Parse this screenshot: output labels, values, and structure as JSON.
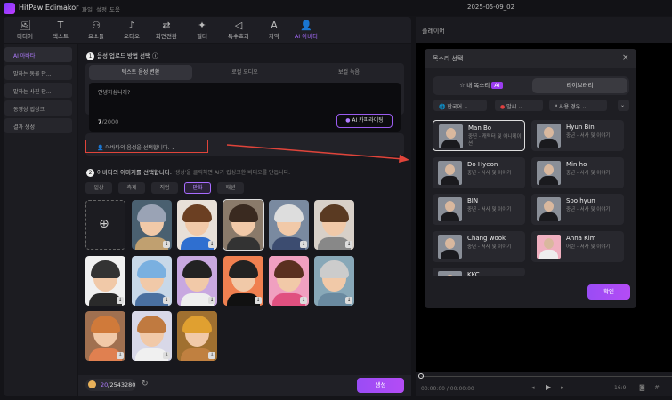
{
  "app": {
    "title": "HitPaw Edimakor",
    "menus": [
      "파일",
      "설정",
      "도움"
    ],
    "date": "2025-05-09_02"
  },
  "toolbar": [
    {
      "icon": "media-icon",
      "glyph": "🖼",
      "label": "미디어"
    },
    {
      "icon": "text-icon",
      "glyph": "T",
      "label": "텍스트"
    },
    {
      "icon": "elements-icon",
      "glyph": "⚇",
      "label": "요소들"
    },
    {
      "icon": "audio-icon",
      "glyph": "♪",
      "label": "오디오"
    },
    {
      "icon": "transition-icon",
      "glyph": "⇄",
      "label": "화면전환"
    },
    {
      "icon": "filter-icon",
      "glyph": "✦",
      "label": "필터"
    },
    {
      "icon": "effects-icon",
      "glyph": "◁",
      "label": "특수효과"
    },
    {
      "icon": "subtitle-icon",
      "glyph": "A",
      "label": "자막"
    },
    {
      "icon": "ai-avatar-icon",
      "glyph": "👤",
      "label": "AI 아바타",
      "active": true
    }
  ],
  "sidebar": [
    "AI 아바타",
    "말하는 동물 만...",
    "말하는 사진 만...",
    "동영상 립싱크",
    "결과 생성"
  ],
  "step1": {
    "num": "1",
    "title": "음성 업로드 방법 선택",
    "tabs": [
      "텍스트 음성 변환",
      "로컬 오디오",
      "보컬 녹음"
    ],
    "text": "안녕하십니까?",
    "count": "7",
    "max": "/2000",
    "ai_button": "AI 카피라이팅",
    "voice_select": "아바타의 음성을 선택합니다."
  },
  "step2": {
    "num": "2",
    "title": "아바타의 이미지를 선택합니다.",
    "hint": "'생성'을 클릭하면 AI가 립싱크한 비디오를 만듭니다.",
    "categories": [
      "일상",
      "축제",
      "직업",
      "만화",
      "패션"
    ],
    "active_category": "만화"
  },
  "avatars": [
    {
      "hair": "#9aa3b5",
      "bg": "#4a6070",
      "body": "#c0a070"
    },
    {
      "hair": "#6b3f22",
      "bg": "#e8e0d8",
      "body": "#2f6fd0"
    },
    {
      "hair": "#3a2a20",
      "bg": "#8a7a6a",
      "body": "#333"
    },
    {
      "hair": "#ddd",
      "bg": "#7a8aa0",
      "body": "#3c4c70"
    },
    {
      "hair": "#5a3a22",
      "bg": "#d8d0c8",
      "body": "#888"
    },
    {
      "hair": "#333",
      "bg": "#f0f0f0",
      "body": "#2a2a2a"
    },
    {
      "hair": "#7ab0e0",
      "bg": "#c8d8e8",
      "body": "#4a70a0"
    },
    {
      "hair": "#222",
      "bg": "#c8a8e0",
      "body": "#eee"
    },
    {
      "hair": "#222",
      "bg": "#f08050",
      "body": "#111"
    },
    {
      "hair": "#5a3020",
      "bg": "#f0a0c0",
      "body": "#e05080"
    },
    {
      "hair": "#ccc",
      "bg": "#88a8b8",
      "body": "#6a8aa0"
    },
    {
      "hair": "#d07a3a",
      "bg": "#a07050",
      "body": "#e08050"
    },
    {
      "hair": "#c07a40",
      "bg": "#d8d8e8",
      "body": "#f0f0f0"
    },
    {
      "hair": "#e0a030",
      "bg": "#a07030",
      "body": "#c08040"
    }
  ],
  "footer": {
    "credits_used": "20",
    "credits_total": "/2543280",
    "generate": "생성"
  },
  "player": {
    "title": "플레이어",
    "time": "00:00:00 / 00:00:00",
    "ratio": "16:9"
  },
  "modal": {
    "title": "목소리 선택",
    "tabs": [
      "내 목소리",
      "라이브러리"
    ],
    "ai_badge": "AI",
    "filters": [
      "한국어",
      "말씨",
      "사용 경우"
    ],
    "confirm": "확인",
    "voices": [
      {
        "name": "Man Bo",
        "desc": "중년 - 캐릭터 및 애니메이션",
        "selected": true
      },
      {
        "name": "Hyun Bin",
        "desc": "중년 - 서사 및 이야기"
      },
      {
        "name": "Do Hyeon",
        "desc": "중년 - 서사 및 이야기"
      },
      {
        "name": "Min ho",
        "desc": "중년 - 서사 및 이야기"
      },
      {
        "name": "BIN",
        "desc": "중년 - 서사 및 이야기"
      },
      {
        "name": "Soo hyun",
        "desc": "중년 - 서사 및 이야기"
      },
      {
        "name": "Chang wook",
        "desc": "중년 - 서사 및 이야기"
      },
      {
        "name": "Anna Kim",
        "desc": "어린 - 서사 및 이야기"
      },
      {
        "name": "KKC",
        "desc": ""
      }
    ]
  },
  "colors": {
    "accent": "#a86cff",
    "highlight": "#e0443a"
  }
}
